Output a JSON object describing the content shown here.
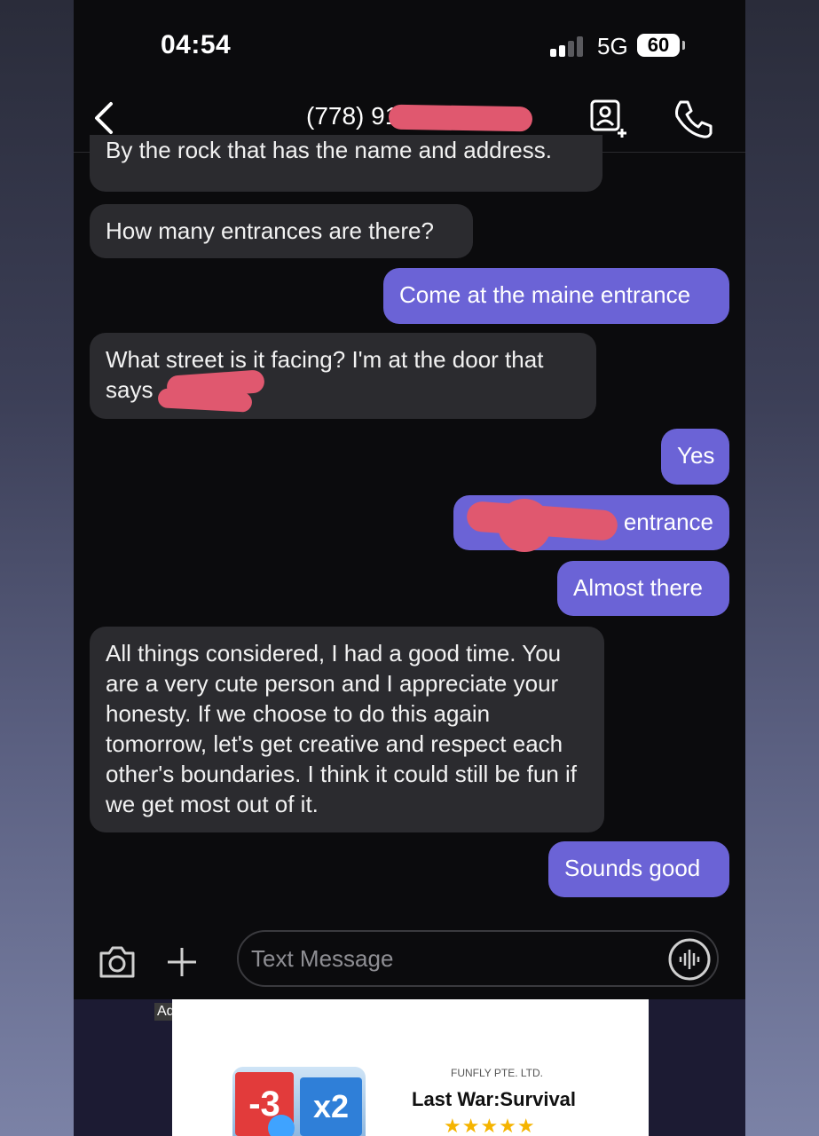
{
  "status_bar": {
    "time": "04:54",
    "network": "5G",
    "battery": "60"
  },
  "header": {
    "contact": "(778) 91",
    "icons": [
      "back-chevron-icon",
      "contact-add-icon",
      "phone-call-icon"
    ]
  },
  "messages": [
    {
      "direction": "incoming",
      "text": "By the rock that has the name and address."
    },
    {
      "direction": "incoming",
      "text": "How many entrances are there?"
    },
    {
      "direction": "outgoing",
      "text": "Come at the maine entrance"
    },
    {
      "direction": "incoming",
      "text": "What street is it facing? I'm at the door that says"
    },
    {
      "direction": "outgoing",
      "text": "Yes"
    },
    {
      "direction": "outgoing",
      "text": "entrance"
    },
    {
      "direction": "outgoing",
      "text": "Almost there"
    },
    {
      "direction": "incoming",
      "text": "All things considered, I had a good time. You are a very cute person and I appreciate your honesty. If we choose to do this again tomorrow, let's get creative and respect each other's boundaries. I think it could still be fun if we get most out of it."
    },
    {
      "direction": "outgoing",
      "text": "Sounds good"
    }
  ],
  "composer": {
    "placeholder": "Text Message",
    "icons": [
      "camera-icon",
      "plus-icon",
      "voice-waveform-icon"
    ]
  },
  "ad": {
    "label": "Ad",
    "company": "FUNFLY PTE. LTD.",
    "title": "Last War:Survival",
    "rating": "★★★★★",
    "rating_value": 4.5,
    "game_badges": [
      "-3",
      "x2"
    ]
  },
  "colors": {
    "outgoing_bubble": "#6b63d6",
    "incoming_bubble": "#2b2b2f",
    "redaction": "#e0586f",
    "star": "#f5b400"
  }
}
